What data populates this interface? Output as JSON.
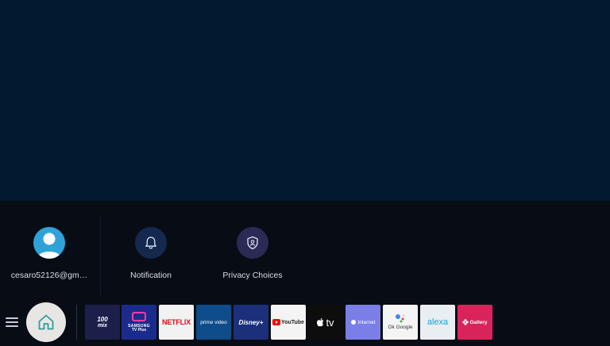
{
  "quick_panel": {
    "account": {
      "label": "cesaro52126@gm…"
    },
    "notification": {
      "label": "Notification"
    },
    "privacy": {
      "label": "Privacy Choices"
    }
  },
  "taskbar": {
    "apps": [
      {
        "name": "100 Mix",
        "line1": "100",
        "line2": "mix",
        "bg": "#1b1f4a",
        "fg": "#ffffff"
      },
      {
        "name": "Samsung TV Plus",
        "line1": "SAMSUNG",
        "line2": "TV Plus",
        "bg": "#1b2b8c",
        "fg": "#ffffff"
      },
      {
        "name": "Netflix",
        "label": "NETFLIX",
        "bg": "#f2f2f2",
        "fg": "#e50914"
      },
      {
        "name": "Prime Video",
        "label": "prime video",
        "bg": "#0f4c8a",
        "fg": "#ffffff"
      },
      {
        "name": "Disney+",
        "label": "Disney+",
        "bg": "#1b2f7a",
        "fg": "#ffffff"
      },
      {
        "name": "YouTube",
        "label": "YouTube",
        "bg": "#f4f4f4",
        "fg": "#222222"
      },
      {
        "name": "Apple TV",
        "label": "tv",
        "bg": "#0d0d0d",
        "fg": "#ffffff"
      },
      {
        "name": "Internet",
        "label": "Internet",
        "bg": "#7a7ee6",
        "fg": "#ffffff"
      },
      {
        "name": "Ok Google",
        "label": "Ok Google",
        "bg": "#f4f4f4",
        "fg": "#333333"
      },
      {
        "name": "Alexa",
        "label": "alexa",
        "bg": "#e8eef2",
        "fg": "#1aa3d4"
      },
      {
        "name": "Gallery",
        "label": "Gallery",
        "bg": "#d8245a",
        "fg": "#ffffff"
      }
    ]
  }
}
